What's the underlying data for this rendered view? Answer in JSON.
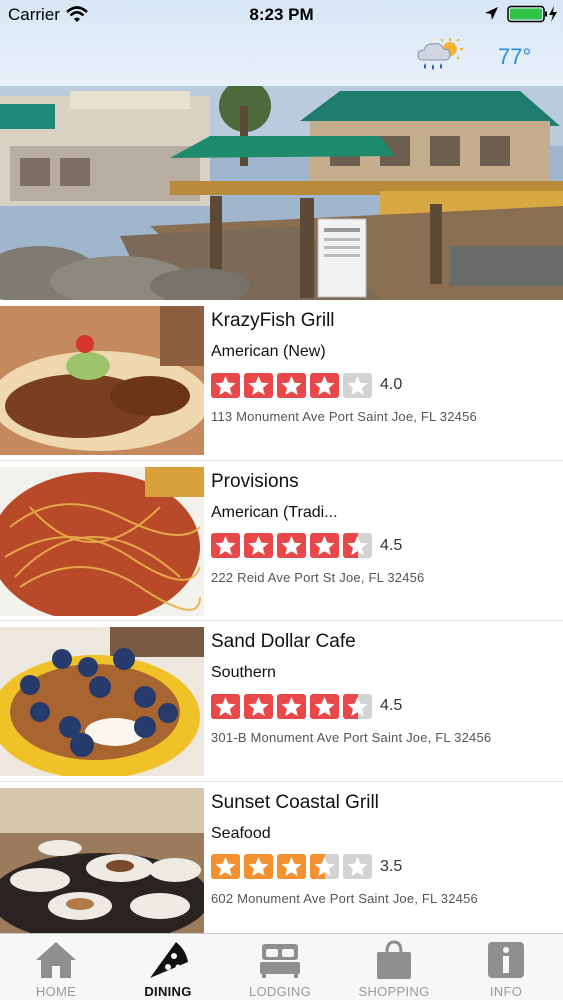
{
  "status_bar": {
    "carrier": "Carrier",
    "time": "8:23 PM"
  },
  "header": {
    "temperature": "77°",
    "weather_icon": "rain-sun-icon"
  },
  "colors": {
    "star_red": "#e8484a",
    "star_orange": "#f3902f",
    "star_empty": "#d3d3d3",
    "temp_blue": "#2b8ee0"
  },
  "restaurants": [
    {
      "name": "KrazyFish Grill",
      "category": "American (New)",
      "rating": 4.0,
      "rating_text": "4.0",
      "address": "113 Monument Ave Port Saint Joe, FL 32456",
      "star_color": "#e8484a"
    },
    {
      "name": "Provisions",
      "category": "American (Tradi...",
      "rating": 4.5,
      "rating_text": "4.5",
      "address": "222 Reid Ave Port St Joe, FL 32456",
      "star_color": "#e8484a"
    },
    {
      "name": "Sand Dollar Cafe",
      "category": "Southern",
      "rating": 4.5,
      "rating_text": "4.5",
      "address": "301-B Monument Ave Port Saint Joe, FL 32456",
      "star_color": "#e8484a"
    },
    {
      "name": "Sunset Coastal Grill",
      "category": "Seafood",
      "rating": 3.5,
      "rating_text": "3.5",
      "address": "602 Monument Ave Port Saint Joe, FL 32456",
      "star_color": "#f3902f"
    }
  ],
  "tabs": [
    {
      "label": "HOME",
      "icon": "home-icon",
      "active": false
    },
    {
      "label": "DINING",
      "icon": "pizza-icon",
      "active": true
    },
    {
      "label": "LODGING",
      "icon": "bed-icon",
      "active": false
    },
    {
      "label": "SHOPPING",
      "icon": "shopping-bag-icon",
      "active": false
    },
    {
      "label": "INFO",
      "icon": "info-icon",
      "active": false
    }
  ]
}
